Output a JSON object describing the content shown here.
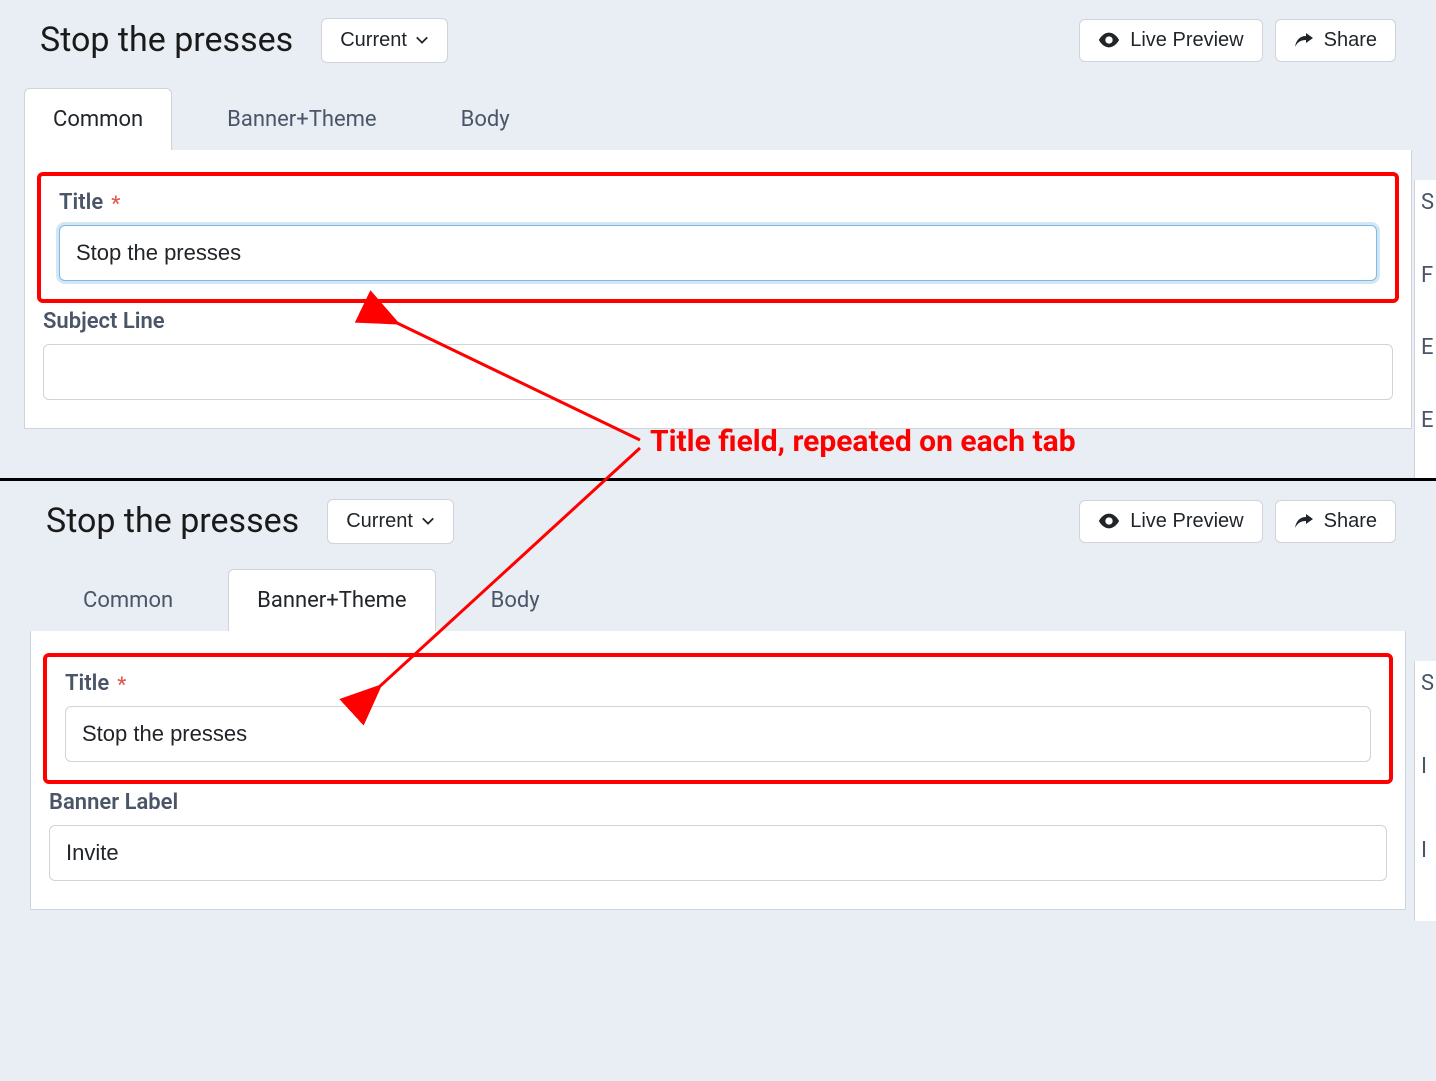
{
  "annotation": {
    "label": "Title field, repeated on each tab"
  },
  "view1": {
    "header": {
      "title": "Stop the presses",
      "version_label": "Current",
      "live_preview_label": "Live Preview",
      "share_label": "Share"
    },
    "tabs": {
      "common": "Common",
      "banner_theme": "Banner+Theme",
      "body": "Body",
      "active": "common"
    },
    "fields": {
      "title_label": "Title",
      "title_value": "Stop the presses",
      "subject_label": "Subject Line",
      "subject_value": ""
    },
    "side_peek": [
      "S",
      "F",
      "E",
      "E"
    ]
  },
  "view2": {
    "header": {
      "title": "Stop the presses",
      "version_label": "Current",
      "live_preview_label": "Live Preview",
      "share_label": "Share"
    },
    "tabs": {
      "common": "Common",
      "banner_theme": "Banner+Theme",
      "body": "Body",
      "active": "banner_theme"
    },
    "fields": {
      "title_label": "Title",
      "title_value": "Stop the presses",
      "banner_label_label": "Banner Label",
      "banner_label_value": "Invite"
    },
    "side_peek": [
      "S",
      "I",
      "I"
    ]
  }
}
